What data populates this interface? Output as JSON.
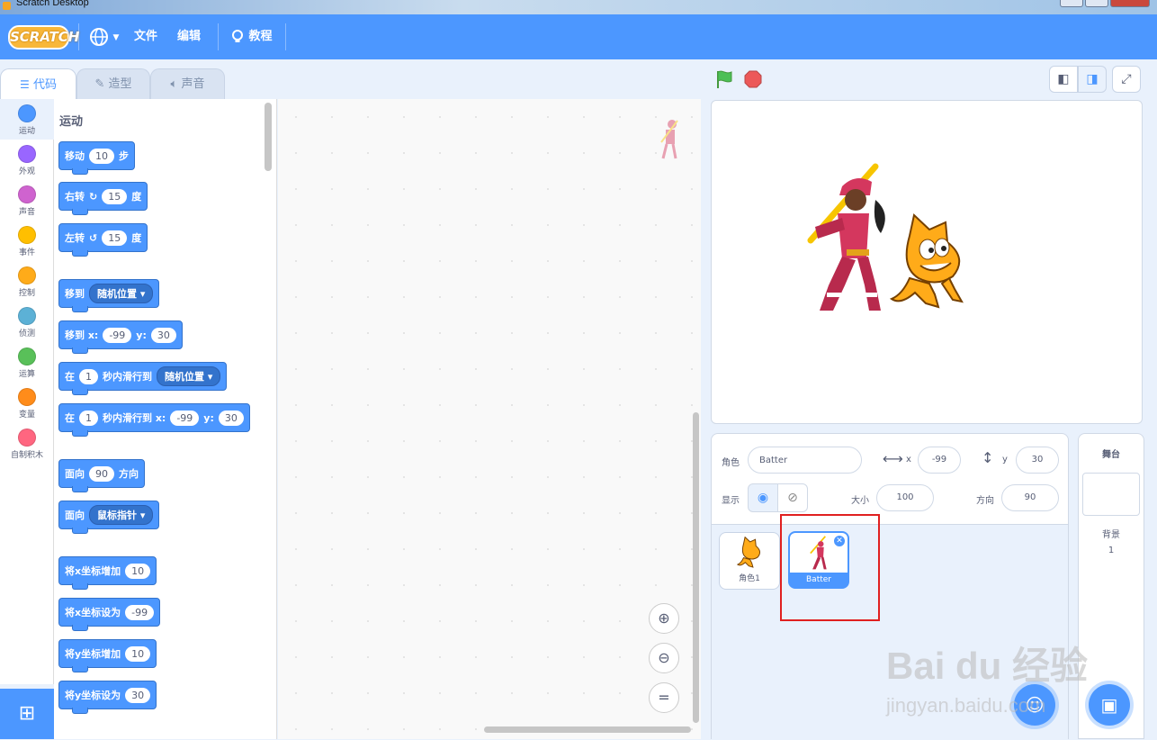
{
  "window": {
    "title": "Scratch Desktop"
  },
  "menubar": {
    "logo": "SCRATCH",
    "file": "文件",
    "edit": "编辑",
    "tutorials": "教程"
  },
  "tabs": {
    "code": "代码",
    "costumes": "造型",
    "sounds": "声音"
  },
  "categories": [
    {
      "label": "运动",
      "color": "#4c97ff"
    },
    {
      "label": "外观",
      "color": "#9966ff"
    },
    {
      "label": "声音",
      "color": "#cf63cf"
    },
    {
      "label": "事件",
      "color": "#ffbf00"
    },
    {
      "label": "控制",
      "color": "#ffab19"
    },
    {
      "label": "侦测",
      "color": "#5cb1d6"
    },
    {
      "label": "运算",
      "color": "#59c059"
    },
    {
      "label": "变量",
      "color": "#ff8c1a"
    },
    {
      "label": "自制积木",
      "color": "#ff6680"
    }
  ],
  "palette": {
    "section_title": "运动",
    "move": {
      "a": "移动",
      "v": "10",
      "b": "步"
    },
    "turn_right": {
      "a": "右转",
      "v": "15",
      "b": "度"
    },
    "turn_left": {
      "a": "左转",
      "v": "15",
      "b": "度"
    },
    "goto": {
      "a": "移到",
      "dd": "随机位置"
    },
    "goto_xy": {
      "a": "移到 x:",
      "x": "-99",
      "yl": "y:",
      "y": "30"
    },
    "glide": {
      "a": "在",
      "v": "1",
      "b": "秒内滑行到",
      "dd": "随机位置"
    },
    "glide_xy": {
      "a": "在",
      "v": "1",
      "b": "秒内滑行到 x:",
      "x": "-99",
      "yl": "y:",
      "y": "30"
    },
    "point_dir": {
      "a": "面向",
      "v": "90",
      "b": "方向"
    },
    "point_towards": {
      "a": "面向",
      "dd": "鼠标指针"
    },
    "change_x": {
      "a": "将x坐标增加",
      "v": "10"
    },
    "set_x": {
      "a": "将x坐标设为",
      "v": "-99"
    },
    "change_y": {
      "a": "将y坐标增加",
      "v": "10"
    },
    "set_y": {
      "a": "将y坐标设为",
      "v": "30"
    }
  },
  "zoom": {
    "in": "+",
    "out": "−",
    "reset": "="
  },
  "sprite_info": {
    "sprite_label": "角色",
    "sprite_name": "Batter",
    "x_label": "x",
    "x_value": "-99",
    "y_label": "y",
    "y_value": "30",
    "show_label": "显示",
    "size_label": "大小",
    "size_value": "100",
    "direction_label": "方向",
    "direction_value": "90"
  },
  "sprites": [
    {
      "name": "角色1",
      "selected": false
    },
    {
      "name": "Batter",
      "selected": true
    }
  ],
  "stage_pane": {
    "title": "舞台",
    "backdrops_label": "背景",
    "backdrops_count": "1"
  },
  "watermark": {
    "line1": "Bai du 经验",
    "line2": "jingyan.baidu.com"
  }
}
